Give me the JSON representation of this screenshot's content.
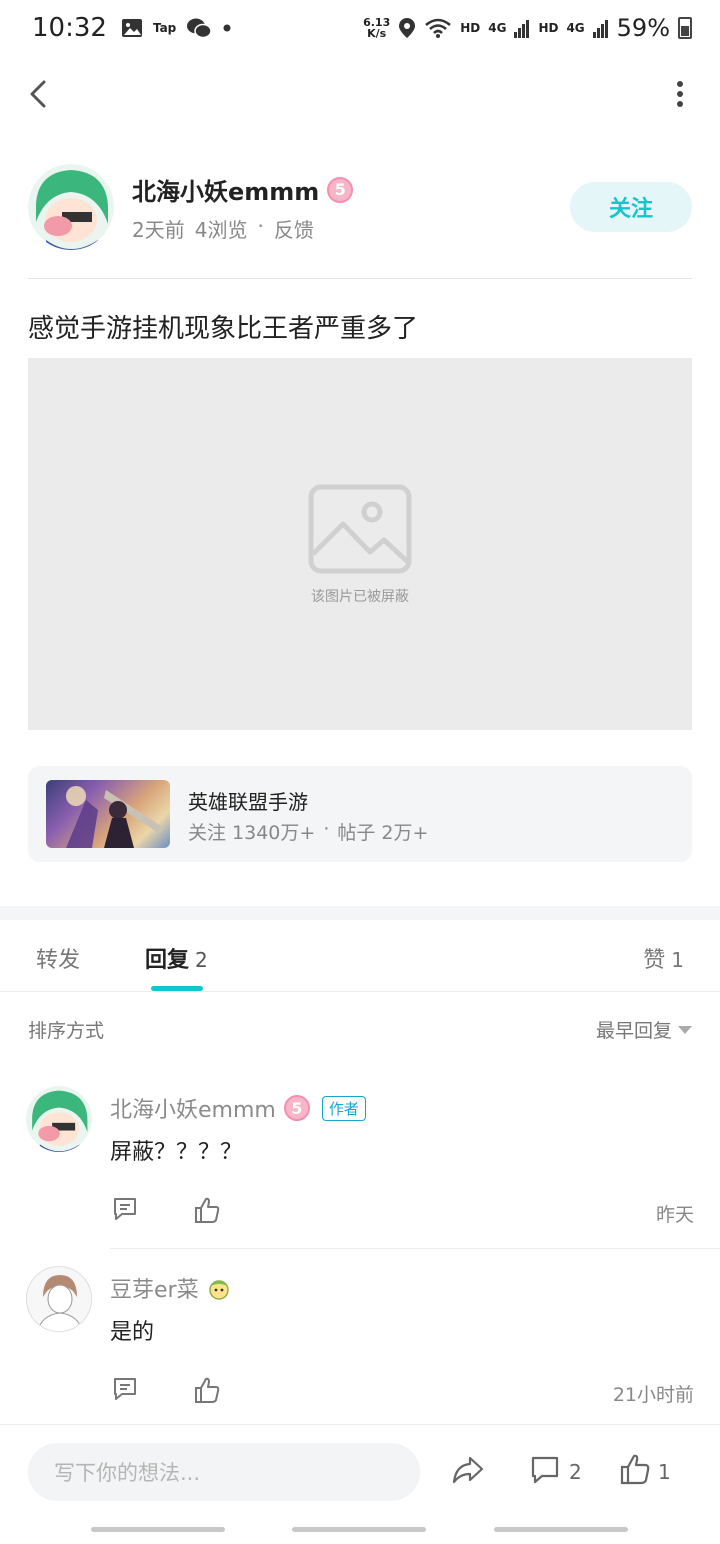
{
  "status_bar": {
    "time": "10:32",
    "tap_label": "Tap",
    "speed_value": "6.13",
    "speed_unit": "K/s",
    "hd1": "HD",
    "net1": "4G",
    "hd2": "HD",
    "net2": "4G",
    "battery": "59%"
  },
  "post": {
    "author_name": "北海小妖emmm",
    "level_badge": "5",
    "time_ago": "2天前",
    "views": "4浏览",
    "meta_dot": "·",
    "feedback": "反馈",
    "follow_label": "关注",
    "title": "感觉手游挂机现象比王者严重多了",
    "blocked_image_text": "该图片已被屏蔽"
  },
  "game_card": {
    "name": "英雄联盟手游",
    "followers": "关注 1340万+",
    "dot": "·",
    "posts": "帖子 2万+"
  },
  "tabs": [
    {
      "label": "转发",
      "count": ""
    },
    {
      "label": "回复",
      "count": "2"
    },
    {
      "label": "赞",
      "count": "1"
    }
  ],
  "sort": {
    "label": "排序方式",
    "selected": "最早回复"
  },
  "replies": [
    {
      "name": "北海小妖emmm",
      "badge": "5",
      "tag": "作者",
      "text": "屏蔽？？？？",
      "time": "昨天"
    },
    {
      "name": "豆芽er菜",
      "badge": "",
      "tag": "",
      "text": "是的",
      "time": "21小时前"
    }
  ],
  "bottom_bar": {
    "input_placeholder": "写下你的想法...",
    "comment_count": "2",
    "like_count": "1"
  },
  "colors": {
    "accent": "#15c5ce",
    "badge_pink": "#f7b5c8",
    "blocked_bg": "#ebebeb"
  }
}
